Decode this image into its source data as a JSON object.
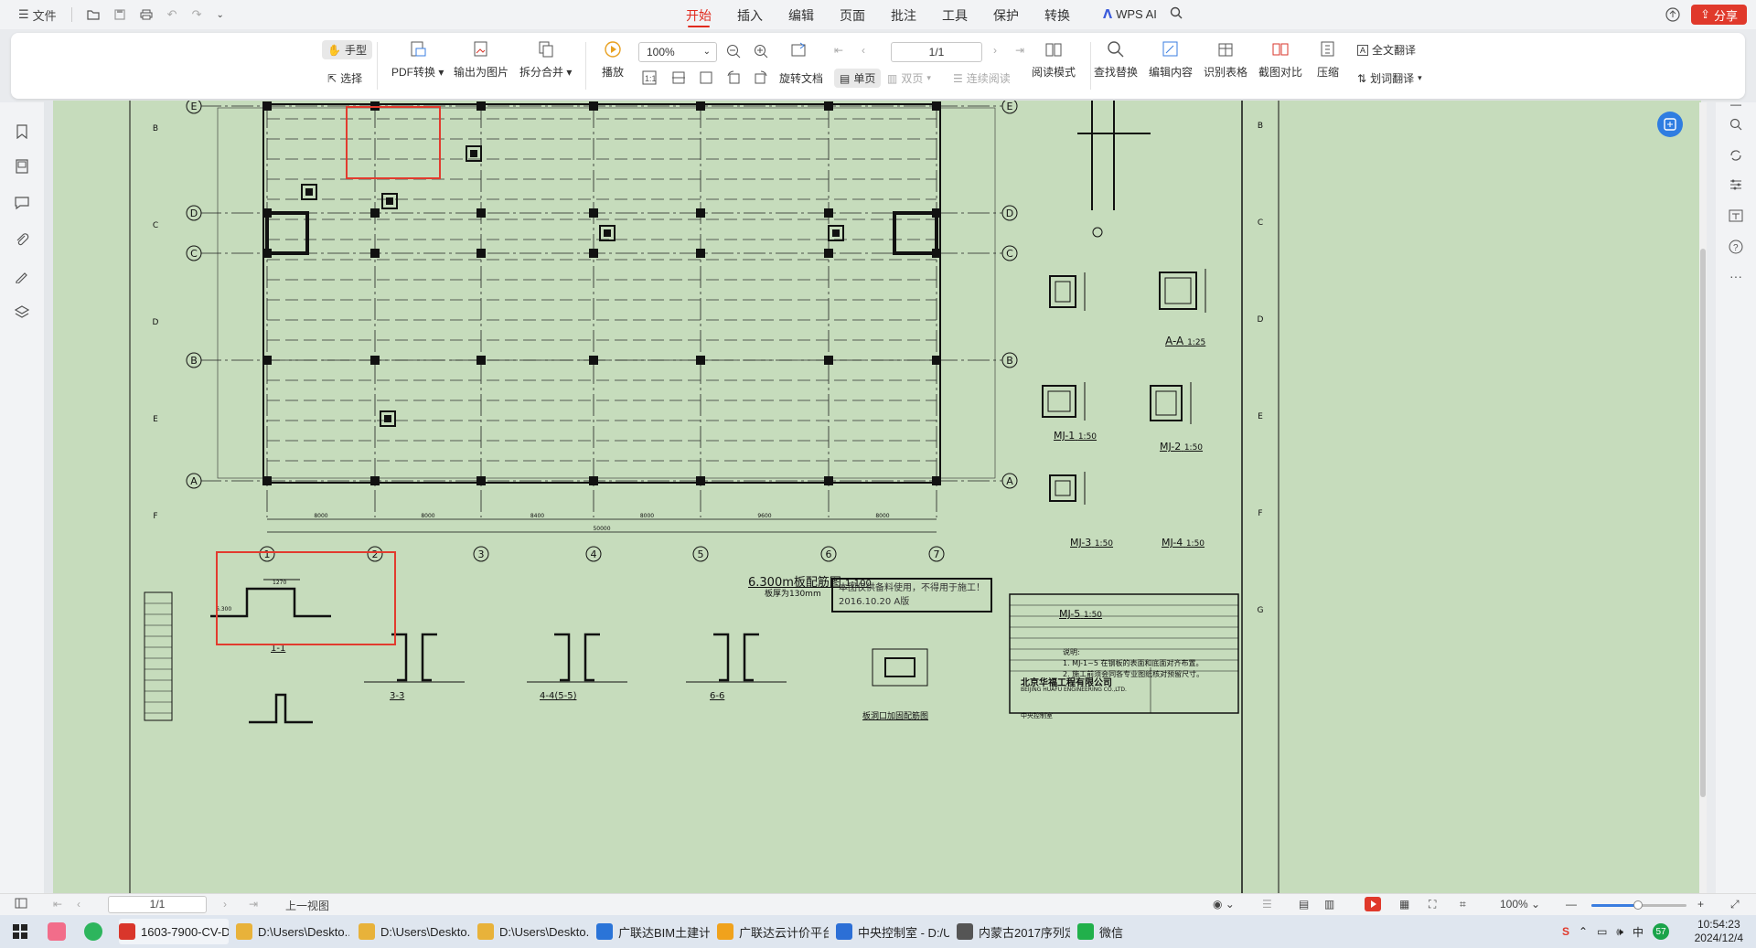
{
  "menubar": {
    "file_label": "文件",
    "tabs": [
      "开始",
      "插入",
      "编辑",
      "页面",
      "批注",
      "工具",
      "保护",
      "转换"
    ],
    "active_tab": "开始",
    "wps_ai_label": "WPS AI",
    "share_label": "分享"
  },
  "ribbon": {
    "hand_label": "手型",
    "select_label": "选择",
    "pdf_convert_label": "PDF转换",
    "export_image_label": "输出为图片",
    "split_merge_label": "拆分合并",
    "play_label": "播放",
    "zoom_value": "100%",
    "page_value": "1/1",
    "rotate_label": "旋转文档",
    "single_page_label": "单页",
    "double_page_label": "双页",
    "continuous_label": "连续阅读",
    "read_mode_label": "阅读模式",
    "find_replace_label": "查找替换",
    "edit_content_label": "编辑内容",
    "recognize_table_label": "识别表格",
    "screenshot_compare_label": "截图对比",
    "compress_label": "压缩",
    "full_translate_label": "全文翻译",
    "word_translate_label": "划词翻译"
  },
  "statusbar": {
    "page_value": "1/1",
    "prev_view_label": "上一视图",
    "zoom_value": "100%"
  },
  "taskbar": {
    "items": [
      {
        "label": "1603-7900-CV-D...",
        "color": "#d9362b"
      },
      {
        "label": "D:\\Users\\Deskto...",
        "color": "#e8b23a"
      },
      {
        "label": "D:\\Users\\Deskto...",
        "color": "#e8b23a"
      },
      {
        "label": "D:\\Users\\Deskto...",
        "color": "#e8b23a"
      },
      {
        "label": "广联达BIM土建计...",
        "color": "#2a74d8"
      },
      {
        "label": "广联达云计价平台...",
        "color": "#f0a21c"
      },
      {
        "label": "中央控制室 - D:/U...",
        "color": "#2c6fd6"
      },
      {
        "label": "内蒙古2017序列定...",
        "color": "#555555"
      },
      {
        "label": "微信",
        "color": "#21b04b"
      }
    ],
    "time": "10:54:23",
    "date": "2024/12/4",
    "tray_badge": "57"
  },
  "drawing": {
    "grid_rows": [
      "E",
      "D",
      "C",
      "B",
      "A"
    ],
    "grid_cols": [
      "1",
      "2",
      "3",
      "4",
      "5",
      "6",
      "7"
    ],
    "border_left": [
      "B",
      "C",
      "D",
      "E",
      "F"
    ],
    "border_right": [
      "B",
      "C",
      "D",
      "E",
      "F",
      "G"
    ],
    "dim_bays": [
      "8000",
      "8000",
      "8400",
      "8000",
      "9600",
      "8000"
    ],
    "dim_total": "50000",
    "plan_title": "6.300m板配筋图",
    "plan_scale": "1:100",
    "plan_subtitle": "板厚为130mm",
    "section_aa": "A-A",
    "section_aa_scale": "1:25",
    "mj_labels": [
      "MJ-1",
      "MJ-2",
      "MJ-3",
      "MJ-4",
      "MJ-5"
    ],
    "mj_scale": "1:50",
    "note_title": "说明:",
    "note_1": "1. MJ-1~5 在钢板的表面和底面对齐布置。",
    "note_2": "2. 施工前须会同各专业图纸核对预留尺寸。",
    "stamp_line1": "本图仅供备料使用，不得用于施工！",
    "stamp_line2": "2016.10.20 A版",
    "sec_11": "1-1",
    "sec_33": "3-3",
    "sec_44": "4-4(5-5)",
    "sec_66": "6-6",
    "sec_opening": "板洞口加固配筋图",
    "company_cn": "北京华福工程有限公司",
    "company_en": "BEIJING HUAFU ENGINEERING CO.,LTD.",
    "title_project": "中央控制室",
    "level_label": "6.300",
    "dim_1270": "1270"
  },
  "colors": {
    "accent_red": "#e02a1e",
    "paper_green": "#c6dcbc",
    "highlight_red": "#e23b2e",
    "link_blue": "#2f7de1"
  }
}
